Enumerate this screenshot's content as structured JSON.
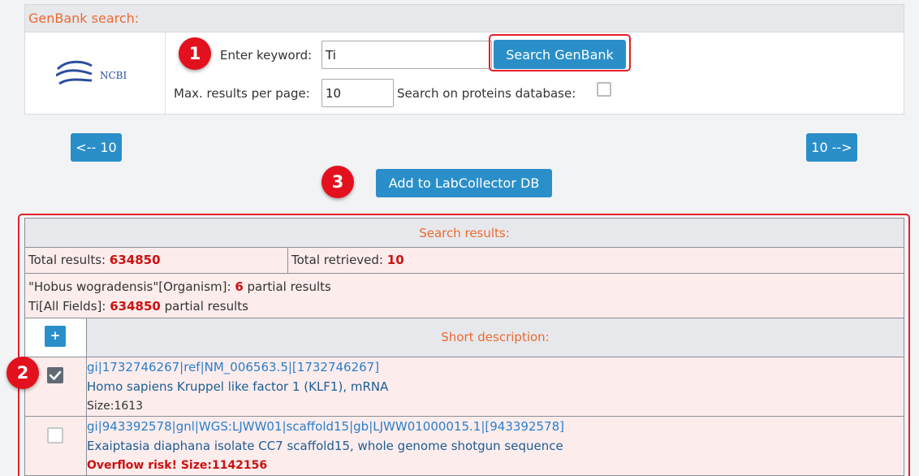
{
  "search_panel": {
    "header": "GenBank search:",
    "keyword_label": "Enter keyword:",
    "keyword_value": "Ti",
    "search_button": "Search GenBank",
    "max_label": "Max. results per page:",
    "max_value": "10",
    "proteins_label": "Search on proteins database:",
    "logo_text": "NCBI"
  },
  "pager": {
    "prev_label": "<-- 10",
    "next_label": "10 -->"
  },
  "add_button": "Add to LabCollector DB",
  "badges": [
    "1",
    "2",
    "3"
  ],
  "results": {
    "header": "Search results:",
    "total_results_label": "Total results:",
    "total_results_value": "634850",
    "total_retrieved_label": "Total retrieved:",
    "total_retrieved_value": "10",
    "partials": [
      {
        "label": "\"Hobus wogradensis\"[Organism]:",
        "value": "6",
        "suffix": "partial results"
      },
      {
        "label": "Ti[All Fields]:",
        "value": "634850",
        "suffix": "partial results"
      }
    ],
    "plus_label": "+",
    "column_header": "Short description:",
    "rows": [
      {
        "checked": true,
        "id": "gi|1732746267|ref|NM_006563.5|[1732746267]",
        "title": "Homo sapiens Kruppel like factor 1 (KLF1), mRNA",
        "size": "Size:1613"
      },
      {
        "checked": false,
        "id": "gi|943392578|gnl|WGS:LJWW01|scaffold15|gb|LJWW01000015.1|[943392578]",
        "title": "Exaiptasia diaphana isolate CC7 scaffold15, whole genome shotgun sequence",
        "size": "Overflow risk! Size:1142156"
      }
    ]
  },
  "colors": {
    "accent_orange": "#ee6a2f",
    "button_blue": "#2a8fc9",
    "highlight_red": "#e3202c",
    "value_red": "#cc1111"
  }
}
